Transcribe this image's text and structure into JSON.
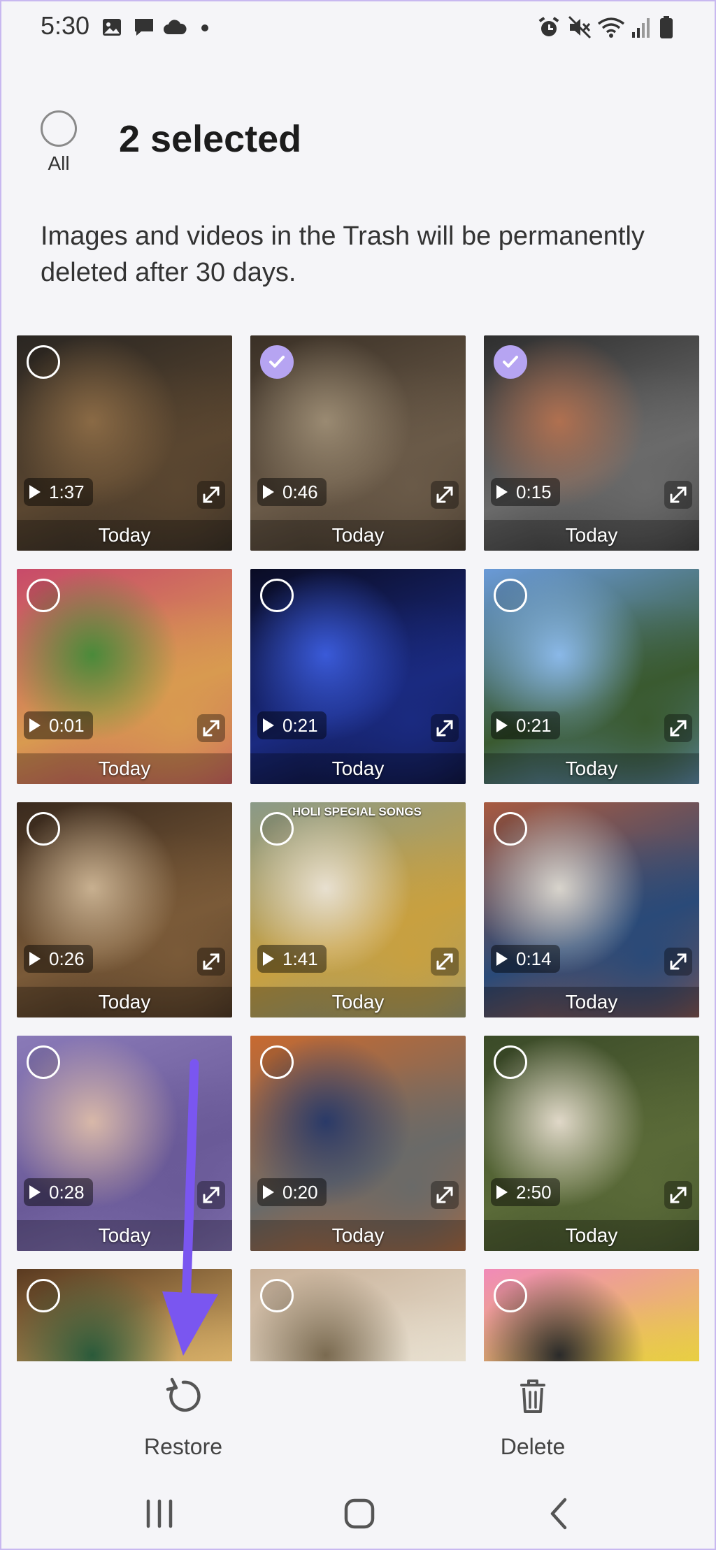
{
  "status_bar": {
    "time": "5:30",
    "left_icons": [
      "gallery-icon",
      "message-icon",
      "cloud-icon",
      "dot-icon"
    ],
    "right_icons": [
      "alarm-icon",
      "mute-icon",
      "wifi-icon",
      "signal-icon",
      "battery-icon"
    ]
  },
  "header": {
    "select_all_label": "All",
    "selected_count_text": "2 selected",
    "trash_notice": "Images and videos in the Trash will be permanently deleted after 30 days."
  },
  "tiles": [
    {
      "duration": "1:37",
      "date": "Today",
      "selected": false,
      "colors": [
        "#2a2622",
        "#5a4630",
        "#8a6a45"
      ]
    },
    {
      "duration": "0:46",
      "date": "Today",
      "selected": true,
      "colors": [
        "#3a3026",
        "#6a5a48",
        "#9a8a72"
      ]
    },
    {
      "duration": "0:15",
      "date": "Today",
      "selected": true,
      "colors": [
        "#2e2e2e",
        "#6a6a6a",
        "#b07050"
      ]
    },
    {
      "duration": "0:01",
      "date": "Today",
      "selected": false,
      "colors": [
        "#c84a6a",
        "#d89a50",
        "#4a8a3a"
      ]
    },
    {
      "duration": "0:21",
      "date": "Today",
      "selected": false,
      "colors": [
        "#0a0c24",
        "#1a2a80",
        "#3a5ad8"
      ]
    },
    {
      "duration": "0:21",
      "date": "Today",
      "selected": false,
      "colors": [
        "#6a9ad8",
        "#3a5a30",
        "#8ab8e8"
      ]
    },
    {
      "duration": "0:26",
      "date": "Today",
      "selected": false,
      "colors": [
        "#3a2a1e",
        "#7a5a38",
        "#c8b090"
      ]
    },
    {
      "duration": "1:41",
      "date": "Today",
      "selected": false,
      "colors": [
        "#8a9a88",
        "#c8a040",
        "#e8e0d0"
      ],
      "overlay_text": "HOLI SPECIAL SONGS"
    },
    {
      "duration": "0:14",
      "date": "Today",
      "selected": false,
      "colors": [
        "#a85a40",
        "#2a4a78",
        "#d8d4cc"
      ]
    },
    {
      "duration": "0:28",
      "date": "Today",
      "selected": false,
      "colors": [
        "#8a7ab8",
        "#6a5a98",
        "#d8b8a8"
      ]
    },
    {
      "duration": "0:20",
      "date": "Today",
      "selected": false,
      "colors": [
        "#c86a30",
        "#6a6a68",
        "#2a3a68"
      ]
    },
    {
      "duration": "2:50",
      "date": "Today",
      "selected": false,
      "colors": [
        "#3a4a28",
        "#5a6a38",
        "#e0d8c8"
      ]
    },
    {
      "duration": "",
      "date": "",
      "selected": false,
      "colors": [
        "#5a3a20",
        "#d8b068",
        "#2a5a3a"
      ]
    },
    {
      "duration": "",
      "date": "",
      "selected": false,
      "colors": [
        "#c8b098",
        "#e8e0d0",
        "#7a6a50"
      ]
    },
    {
      "duration": "",
      "date": "",
      "selected": false,
      "colors": [
        "#f08ab8",
        "#e8d040",
        "#2a2a2a"
      ]
    }
  ],
  "toolbar": {
    "restore_label": "Restore",
    "delete_label": "Delete"
  },
  "nav": {
    "recents": "recents-icon",
    "home": "home-icon",
    "back": "back-icon"
  },
  "colors": {
    "accent": "#b6a4f2",
    "arrow": "#7a56f0",
    "background": "#f5f5f8"
  }
}
